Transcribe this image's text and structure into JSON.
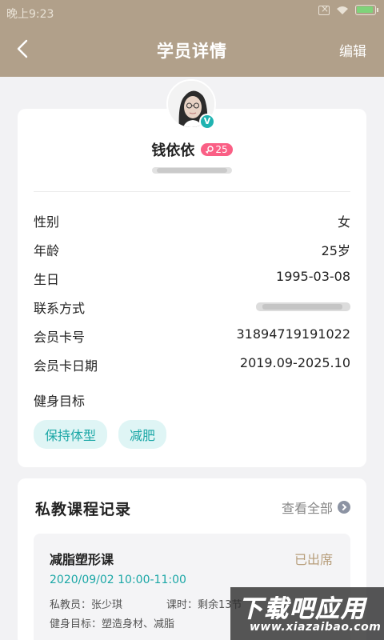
{
  "status_bar": {
    "time": "晚上9:23"
  },
  "header": {
    "title": "学员详情",
    "edit_label": "编辑"
  },
  "profile": {
    "name": "钱依依",
    "gender_age_badge": "25",
    "verified_badge": "V",
    "info_rows": [
      {
        "label": "性别",
        "value": "女"
      },
      {
        "label": "年龄",
        "value": "25岁"
      },
      {
        "label": "生日",
        "value": "1995-03-08"
      },
      {
        "label": "联系方式",
        "value": ""
      },
      {
        "label": "会员卡号",
        "value": "31894719191022"
      },
      {
        "label": "会员卡日期",
        "value": "2019.09-2025.10"
      }
    ],
    "goal_title": "健身目标",
    "goal_tags": [
      "保持体型",
      "减肥"
    ]
  },
  "records": {
    "title": "私教课程记录",
    "view_all": "查看全部",
    "items": [
      {
        "course": "减脂塑形课",
        "status": "已出席",
        "time": "2020/09/02 10:00-11:00",
        "coach": "私教员：张少琪",
        "hours": "课时：剩余13节",
        "goals": "健身目标：塑造身材、减脂"
      }
    ]
  },
  "watermark": {
    "main": "下载吧应用",
    "sub": "www.xiazaibao.com"
  },
  "colors": {
    "header_bg": "#b1a08a",
    "accent_teal": "#1ba7a6",
    "tag_bg": "#dff5f5",
    "badge_pink": "#fa5f85",
    "status_gold": "#b79e7b"
  }
}
